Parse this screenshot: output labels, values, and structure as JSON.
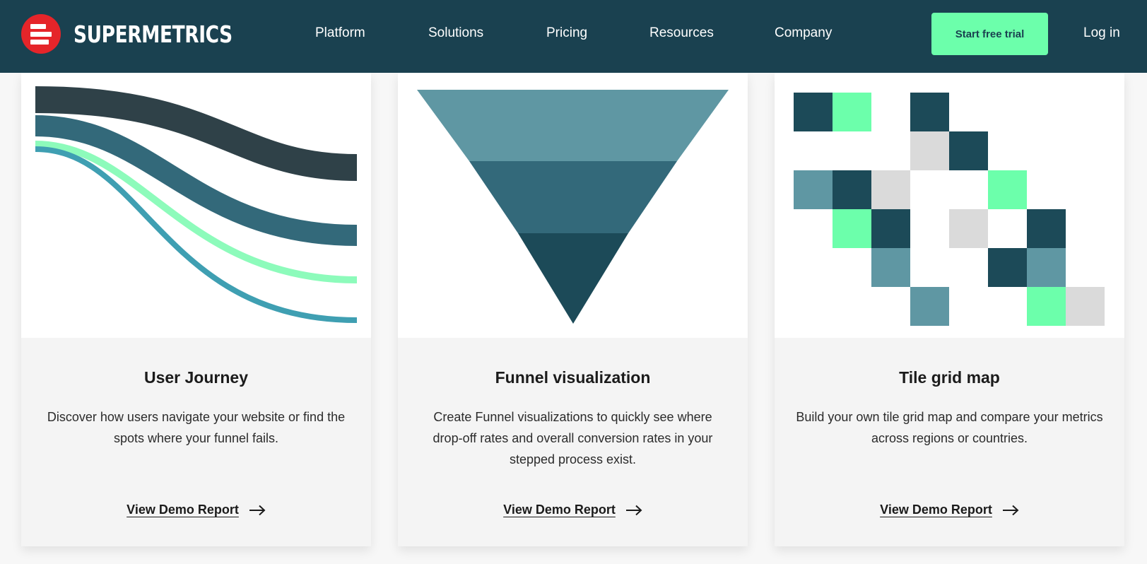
{
  "brand": {
    "name": "SUPERMETRICS",
    "logo_icon": "supermetrics-logo-icon",
    "colors": {
      "navbar": "#1a4150",
      "logo_red": "#e5252a",
      "accent_green": "#6cffab"
    }
  },
  "nav": {
    "items": [
      "Platform",
      "Solutions",
      "Pricing",
      "Resources",
      "Company"
    ],
    "cta_label": "Start free trial",
    "login_label": "Log in"
  },
  "cards": [
    {
      "title": "User Journey",
      "description": "Discover how users navigate your website or find the spots where your funnel fails.",
      "link_label": "View Demo Report",
      "visual": "sankey-flow-illustration",
      "link_icon": "arrow-right-icon"
    },
    {
      "title": "Funnel visualization",
      "description": "Create Funnel visualizations to quickly see where drop-off rates and overall conversion rates in your stepped process exist.",
      "link_label": "View Demo Report",
      "visual": "funnel-illustration",
      "link_icon": "arrow-right-icon"
    },
    {
      "title": "Tile grid map",
      "description": "Build your own tile grid map and compare your metrics across regions or countries.",
      "link_label": "View Demo Report",
      "visual": "tile-grid-illustration",
      "link_icon": "arrow-right-icon"
    }
  ],
  "illustration_colors": {
    "charcoal": "#2f4148",
    "dark_teal": "#1c4a58",
    "mid_teal": "#33697a",
    "light_teal": "#5f97a3",
    "bright_teal": "#3f9fb2",
    "mint": "#6cffab",
    "pale_mint": "#8dfbbb",
    "gray": "#dadada"
  }
}
